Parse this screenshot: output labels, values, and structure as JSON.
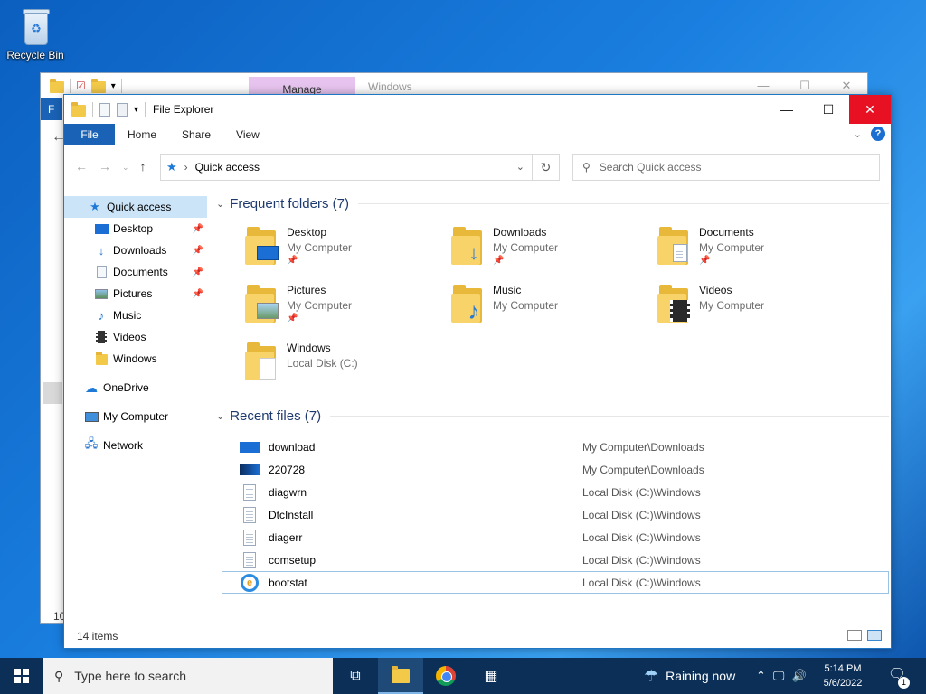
{
  "desktop": {
    "recycle_bin_label": "Recycle Bin"
  },
  "back_window": {
    "manage_tab": "Manage",
    "title": "Windows",
    "ribbon_file_initial": "F",
    "status_count": "10"
  },
  "window": {
    "title": "File Explorer",
    "ribbon_tabs": {
      "file": "File",
      "home": "Home",
      "share": "Share",
      "view": "View"
    },
    "address_path": "Quick access",
    "search_placeholder": "Search Quick access",
    "status_items": "14 items"
  },
  "nav": {
    "quick_access": "Quick access",
    "pinned": [
      {
        "label": "Desktop",
        "icon": "desktop-icon"
      },
      {
        "label": "Downloads",
        "icon": "download-arrow-icon"
      },
      {
        "label": "Documents",
        "icon": "documents-icon"
      },
      {
        "label": "Pictures",
        "icon": "pictures-icon"
      },
      {
        "label": "Music",
        "icon": "music-note-icon"
      },
      {
        "label": "Videos",
        "icon": "film-icon"
      },
      {
        "label": "Windows",
        "icon": "folder-icon"
      }
    ],
    "onedrive": "OneDrive",
    "my_computer": "My Computer",
    "network": "Network"
  },
  "frequent": {
    "heading": "Frequent folders (7)",
    "items": [
      {
        "name": "Desktop",
        "location": "My Computer",
        "pinned": true
      },
      {
        "name": "Downloads",
        "location": "My Computer",
        "pinned": true
      },
      {
        "name": "Documents",
        "location": "My Computer",
        "pinned": true
      },
      {
        "name": "Pictures",
        "location": "My Computer",
        "pinned": true
      },
      {
        "name": "Music",
        "location": "My Computer",
        "pinned": false
      },
      {
        "name": "Videos",
        "location": "My Computer",
        "pinned": false
      },
      {
        "name": "Windows",
        "location": "Local Disk (C:)",
        "pinned": false
      }
    ]
  },
  "recent": {
    "heading": "Recent files (7)",
    "items": [
      {
        "name": "download",
        "path": "My Computer\\Downloads"
      },
      {
        "name": "220728",
        "path": "My Computer\\Downloads"
      },
      {
        "name": "diagwrn",
        "path": "Local Disk (C:)\\Windows"
      },
      {
        "name": "DtcInstall",
        "path": "Local Disk (C:)\\Windows"
      },
      {
        "name": "diagerr",
        "path": "Local Disk (C:)\\Windows"
      },
      {
        "name": "comsetup",
        "path": "Local Disk (C:)\\Windows"
      },
      {
        "name": "bootstat",
        "path": "Local Disk (C:)\\Windows"
      }
    ]
  },
  "taskbar": {
    "search_placeholder": "Type here to search",
    "weather": "Raining now",
    "time": "5:14 PM",
    "date": "5/6/2022",
    "notification_count": "1"
  },
  "colors": {
    "accent": "#1a62b5",
    "close_red": "#e81123",
    "nav_selected": "#cce4f7",
    "section_heading": "#1e3a6f"
  }
}
